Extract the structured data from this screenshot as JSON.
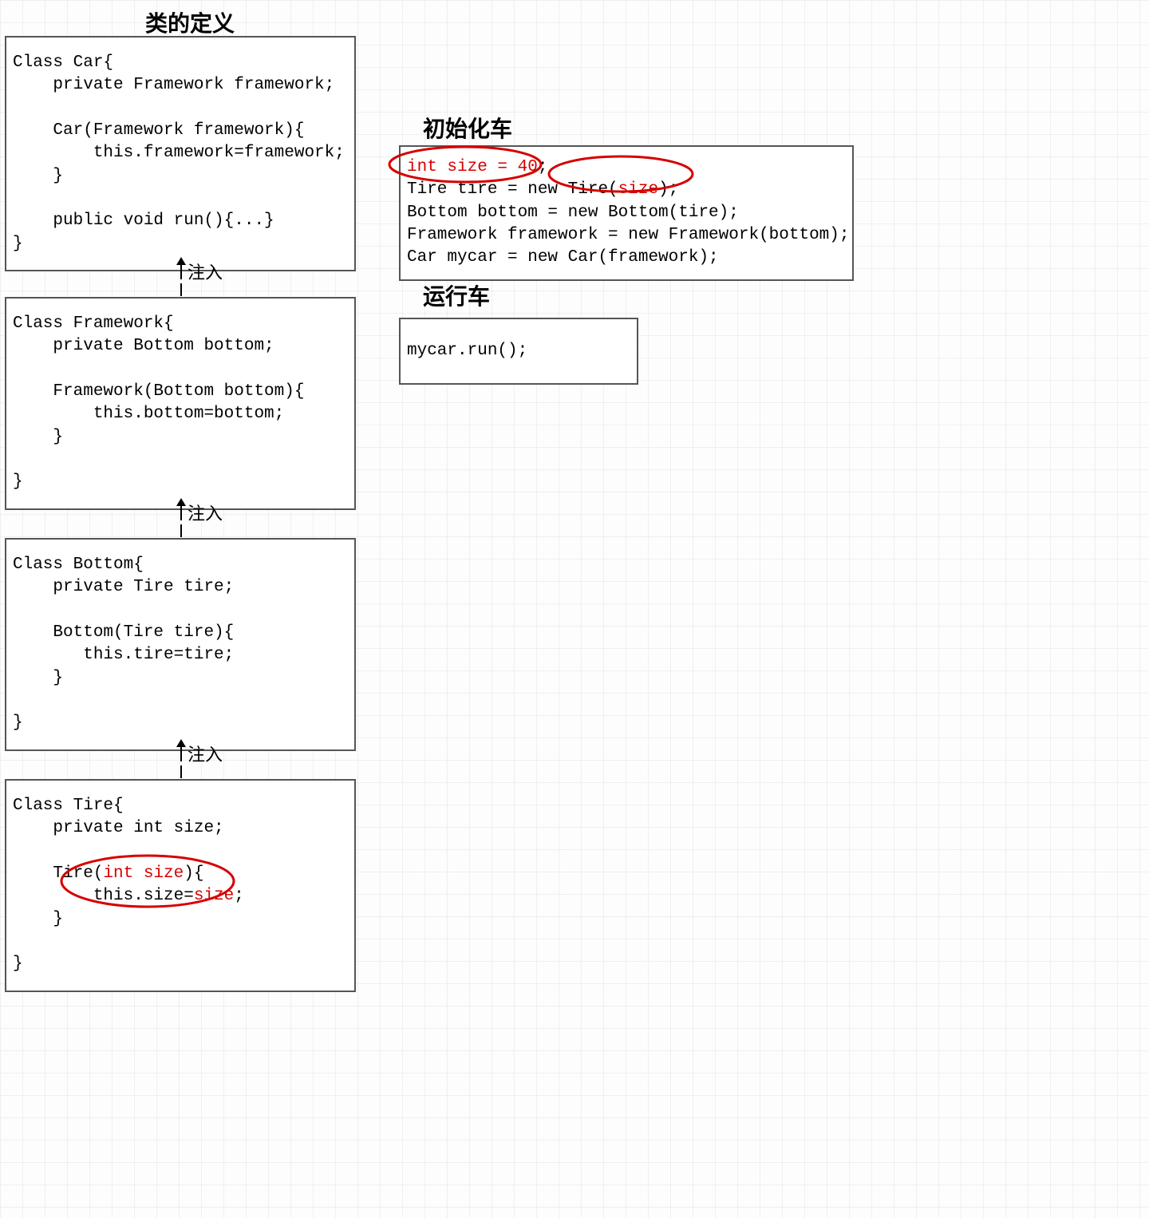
{
  "titles": {
    "classDef": "类的定义",
    "initCar": "初始化车",
    "runCar": "运行车"
  },
  "arrowLabel": "注入",
  "left": {
    "car": {
      "l1": "Class Car{",
      "l2": "    private Framework framework;",
      "l3": "",
      "l4": "    Car(Framework framework){",
      "l5": "        this.framework=framework;",
      "l6": "    }",
      "l7": "",
      "l8": "    public void run(){...}",
      "l9": "}"
    },
    "framework": {
      "l1": "Class Framework{",
      "l2": "    private Bottom bottom;",
      "l3": "",
      "l4": "    Framework(Bottom bottom){",
      "l5": "        this.bottom=bottom;",
      "l6": "    }",
      "l7": "",
      "l8": "}"
    },
    "bottom": {
      "l1": "Class Bottom{",
      "l2": "    private Tire tire;",
      "l3": "",
      "l4": "    Bottom(Tire tire){",
      "l5": "       this.tire=tire;",
      "l6": "    }",
      "l7": "",
      "l8": "}"
    },
    "tire": {
      "l1": "Class Tire{",
      "l2": "    private int size;",
      "l3": "",
      "l4a": "    Tire(",
      "l4b": "int size",
      "l4c": "){",
      "l5a": "        this.size=",
      "l5b": "size",
      "l5c": ";",
      "l6": "    }",
      "l7": "",
      "l8": "}"
    }
  },
  "right": {
    "init": {
      "l1a": "int size = 40",
      "l1b": ";",
      "l2a": "Tire tire = new Tire(",
      "l2b": "size",
      "l2c": ");",
      "l3": "Bottom bottom = new Bottom(tire);",
      "l4": "Framework framework = new Framework(bottom);",
      "l5": "Car mycar = new Car(framework);"
    },
    "run": {
      "l1": "mycar.run();"
    }
  }
}
